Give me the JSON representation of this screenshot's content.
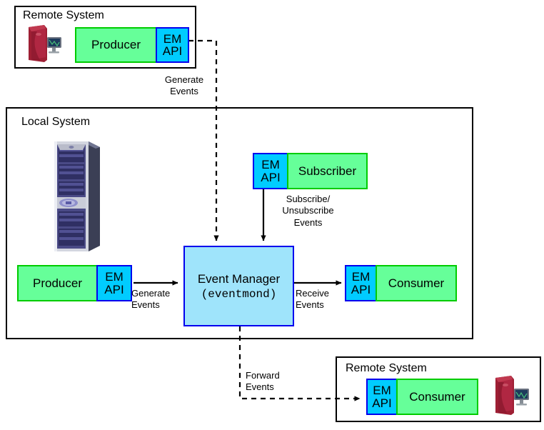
{
  "diagram": {
    "title_remote_top": "Remote System",
    "title_local": "Local System",
    "title_remote_bottom": "Remote System",
    "colors": {
      "component_fill": "#66ff99",
      "component_border": "#00cc00",
      "api_fill": "#00ccff",
      "api_border": "#0000ee",
      "event_manager_fill": "#9fe4fb",
      "event_manager_border": "#0000ee",
      "line": "#000000"
    },
    "nodes": {
      "remote_producer": "Producer",
      "remote_producer_api_line1": "EM",
      "remote_producer_api_line2": "API",
      "subscriber_api_line1": "EM",
      "subscriber_api_line2": "API",
      "subscriber": "Subscriber",
      "local_producer": "Producer",
      "local_producer_api_line1": "EM",
      "local_producer_api_line2": "API",
      "event_manager_title": "Event Manager",
      "event_manager_process": "(eventmond)",
      "local_consumer_api_line1": "EM",
      "local_consumer_api_line2": "API",
      "local_consumer": "Consumer",
      "remote_consumer_api_line1": "EM",
      "remote_consumer_api_line2": "API",
      "remote_consumer": "Consumer"
    },
    "edge_labels": {
      "remote_generate": "Generate\nEvents",
      "subscribe": "Subscribe/\nUnsubscribe\nEvents",
      "local_generate": "Generate\nEvents",
      "receive": "Receive\nEvents",
      "forward": "Forward\nEvents"
    },
    "images": {
      "remote_workstation_top": "red-workstation-image",
      "local_server": "blue-rack-server-image",
      "remote_workstation_bottom": "red-workstation-image"
    }
  }
}
